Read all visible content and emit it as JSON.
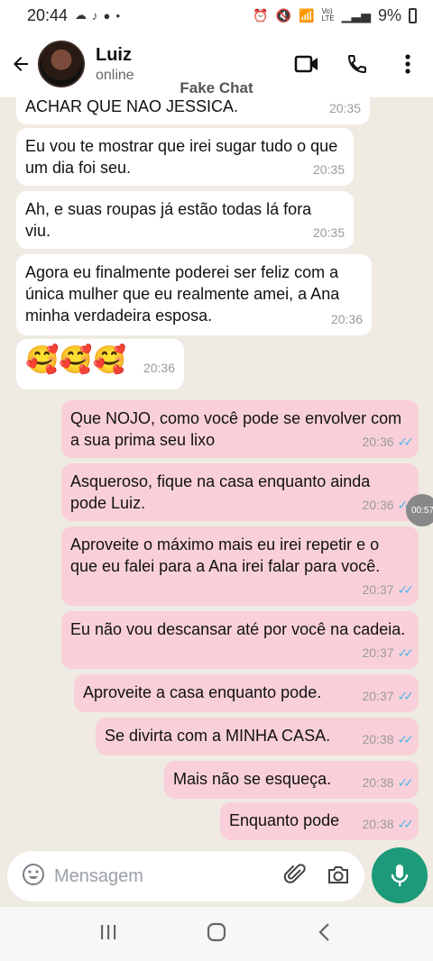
{
  "status_bar": {
    "time": "20:44",
    "notification_icons": [
      "cloud-icon",
      "tiktok-icon",
      "message-icon",
      "dot"
    ],
    "status_icons": [
      "alarm-icon",
      "mute-icon",
      "wifi-icon",
      "volte-icon",
      "signal-icon"
    ],
    "volte_text": "Vo)\nLTE",
    "battery": "9%"
  },
  "header": {
    "contact_name": "Luiz",
    "contact_status": "online",
    "watermark": "Fake Chat"
  },
  "messages": [
    {
      "dir": "in",
      "text": "ACHAR QUE NAO JESSICA.",
      "time": "20:35"
    },
    {
      "dir": "in",
      "text": "Eu vou te mostrar que irei sugar tudo o que um dia foi seu.",
      "time": "20:35"
    },
    {
      "dir": "in",
      "text": "Ah, e suas roupas já estão todas lá fora viu.",
      "time": "20:35"
    },
    {
      "dir": "in",
      "text": "Agora eu finalmente poderei ser feliz com a única mulher que eu realmente amei, a Ana minha verdadeira esposa.",
      "time": "20:36"
    },
    {
      "dir": "in",
      "text": "🥰🥰🥰",
      "time": "20:36"
    },
    {
      "dir": "out",
      "text": "Que NOJO, como você pode se envolver com a sua prima seu lixo",
      "time": "20:36"
    },
    {
      "dir": "out",
      "text": "Asqueroso, fique na casa enquanto ainda pode Luiz.",
      "time": "20:36"
    },
    {
      "dir": "out",
      "text": "Aproveite o máximo mais eu irei repetir e o que eu falei para a Ana irei falar para você.",
      "time": "20:37"
    },
    {
      "dir": "out",
      "text": "Eu não vou descansar até por você na cadeia.",
      "time": "20:37"
    },
    {
      "dir": "out",
      "text": "Aproveite a casa enquanto pode.",
      "time": "20:37"
    },
    {
      "dir": "out",
      "text": "Se divirta com a MINHA CASA.",
      "time": "20:38"
    },
    {
      "dir": "out",
      "text": "Mais não se esqueça.",
      "time": "20:38"
    },
    {
      "dir": "out",
      "text": "Enquanto pode",
      "time": "20:38"
    }
  ],
  "floating_timer": "00:57",
  "composer": {
    "placeholder": "Mensagem"
  },
  "colors": {
    "incoming_bubble": "#ffffff",
    "outgoing_bubble": "#f9d0d9",
    "read_ticks": "#4fb6ec",
    "mic_button": "#1d9a7a"
  }
}
